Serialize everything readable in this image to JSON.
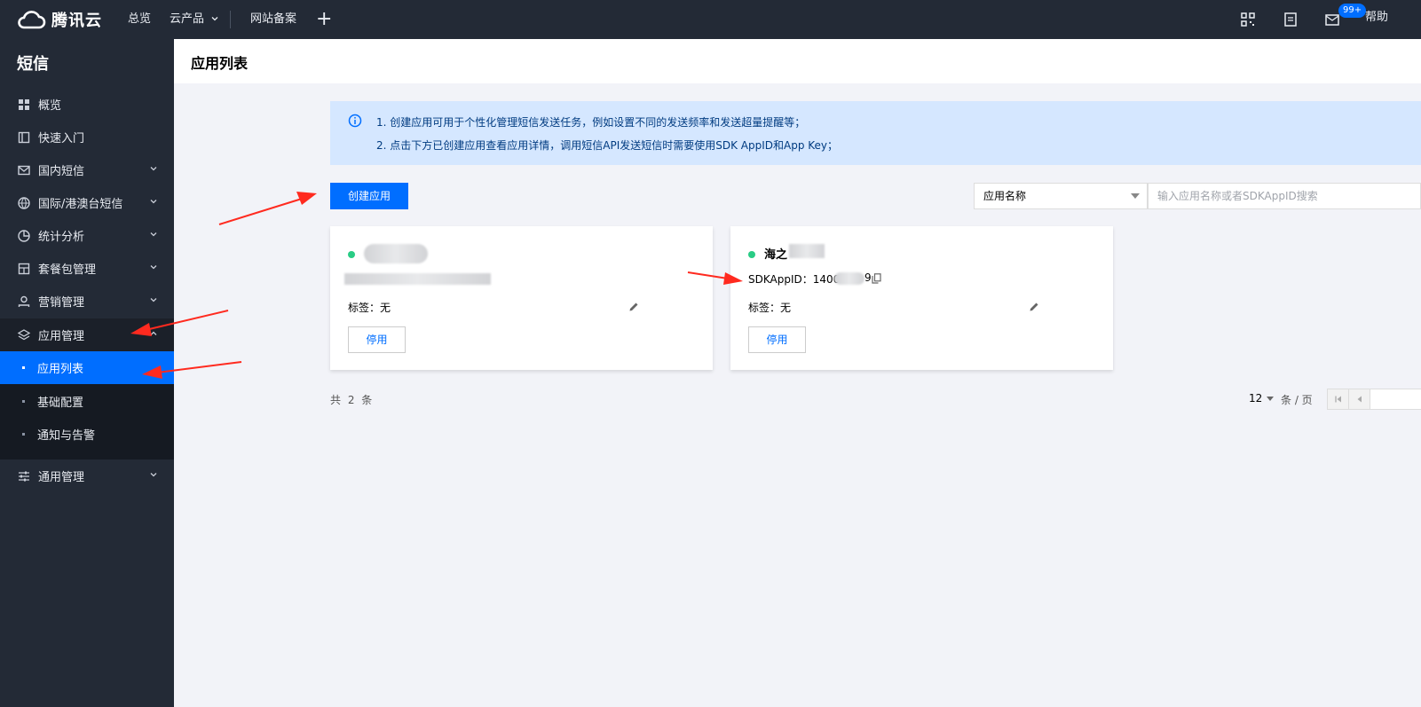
{
  "topbar": {
    "brand": "腾讯云",
    "nav": [
      "总览",
      "云产品",
      "网站备案"
    ],
    "badge": "99+",
    "help": "帮助"
  },
  "sidebar": {
    "title": "短信",
    "items": [
      {
        "label": "概览",
        "icon": "grid-icon"
      },
      {
        "label": "快速入门",
        "icon": "book-icon"
      },
      {
        "label": "国内短信",
        "icon": "mail-icon"
      },
      {
        "label": "国际/港澳台短信",
        "icon": "globe-icon"
      },
      {
        "label": "统计分析",
        "icon": "pie-chart-icon"
      },
      {
        "label": "套餐包管理",
        "icon": "package-icon"
      },
      {
        "label": "营销管理",
        "icon": "user-icon"
      },
      {
        "label": "应用管理",
        "icon": "layers-icon"
      },
      {
        "label": "通用管理",
        "icon": "sliders-icon"
      }
    ],
    "subitems": [
      "应用列表",
      "基础配置",
      "通知与告警"
    ]
  },
  "page": {
    "title": "应用列表"
  },
  "info": {
    "line1": "1. 创建应用可用于个性化管理短信发送任务，例如设置不同的发送频率和发送超量提醒等；",
    "line2": "2. 点击下方已创建应用查看应用详情，调用短信API发送短信时需要使用SDK AppID和App Key；"
  },
  "toolbar": {
    "create_label": "创建应用",
    "filter_selected": "应用名称",
    "search_placeholder": "输入应用名称或者SDKAppID搜索"
  },
  "cards": [
    {
      "name": "",
      "appid": "",
      "tag": "标签：无",
      "disable_label": "停用"
    },
    {
      "name": "海之",
      "appid": "SDKAppID：1400",
      "appid_tail": "9",
      "tag": "标签：无",
      "disable_label": "停用"
    }
  ],
  "footer": {
    "total": "共 2 条",
    "page_size": "12",
    "page_unit": "条 / 页"
  },
  "colors": {
    "accent": "#006eff",
    "nav_bg": "#232a36",
    "status_ok": "#29cc85",
    "annotation": "#ff2a1f"
  }
}
